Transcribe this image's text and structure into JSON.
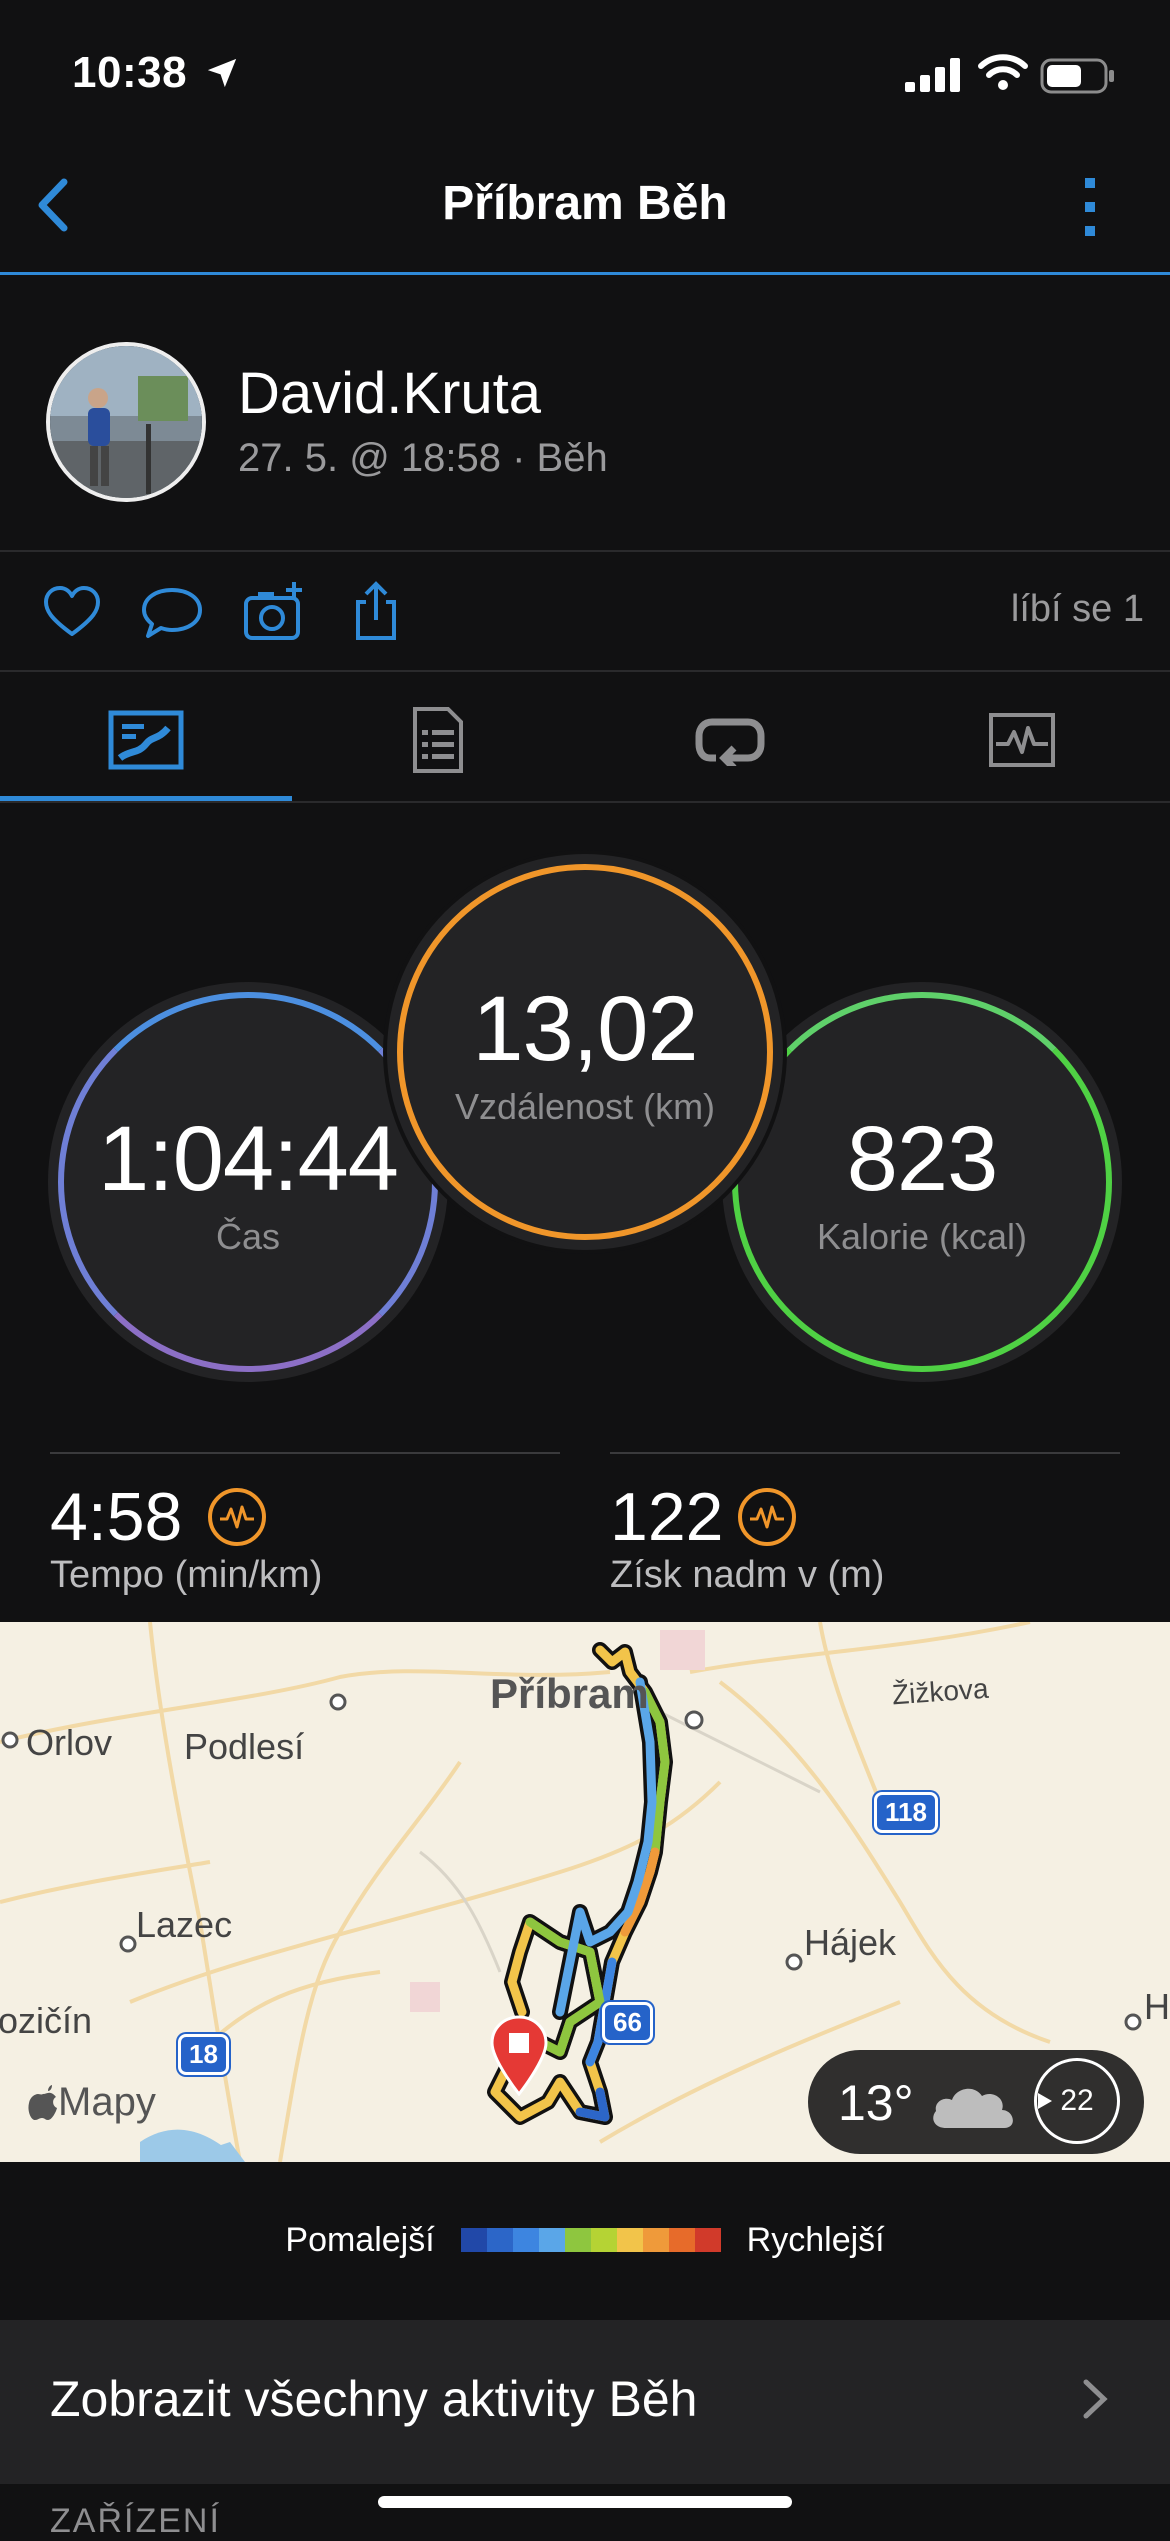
{
  "status": {
    "time": "10:38"
  },
  "nav": {
    "title": "Příbram Běh"
  },
  "profile": {
    "name": "David.Kruta",
    "meta": "27. 5. @ 18:58 · Běh"
  },
  "actions": {
    "likes": "líbí se 1"
  },
  "tabs": [
    {
      "icon": "overview-icon",
      "active": true
    },
    {
      "icon": "details-icon",
      "active": false
    },
    {
      "icon": "laps-icon",
      "active": false
    },
    {
      "icon": "charts-icon",
      "active": false
    }
  ],
  "metrics": {
    "time": {
      "value": "1:04:44",
      "label": "Čas"
    },
    "distance": {
      "value": "13,02",
      "label": "Vzdálenost (km)"
    },
    "calories": {
      "value": "823",
      "label": "Kalorie (kcal)"
    }
  },
  "stats": [
    {
      "value": "4:58",
      "label": "Tempo (min/km)"
    },
    {
      "value": "122",
      "label": "Získ nadm v (m)"
    }
  ],
  "map": {
    "places": [
      "Příbram",
      "Orlov",
      "Podlesí",
      "Žižkova",
      "Lazec",
      "Hájek",
      "ozičín",
      "H"
    ],
    "roads": [
      "118",
      "66",
      "18"
    ],
    "attribution": "Mapy",
    "weather": {
      "temp": "13°",
      "wind": "22"
    }
  },
  "legend": {
    "slow": "Pomalejší",
    "fast": "Rychlejší",
    "colors": [
      "#2148a8",
      "#2c66c8",
      "#3d85e0",
      "#5aa6e8",
      "#8ec63f",
      "#b5d334",
      "#f2c44a",
      "#ef9a3a",
      "#e76b2a",
      "#d13a2a"
    ]
  },
  "footer": {
    "all_activities": "Zobrazit všechny aktivity Běh",
    "section": "ZAŘÍZENÍ"
  }
}
